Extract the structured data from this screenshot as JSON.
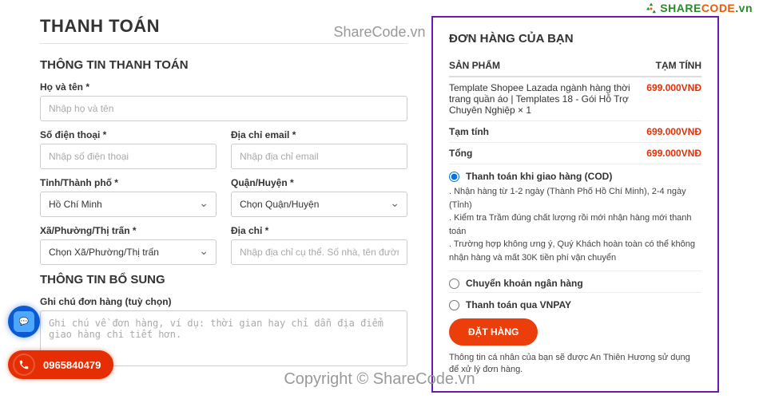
{
  "page_title": "THANH TOÁN",
  "watermark_top": "ShareCode.vn",
  "watermark_bottom": "Copyright © ShareCode.vn",
  "logo_text_1": "SHARE",
  "logo_text_2": "CODE",
  "logo_text_3": ".vn",
  "billing": {
    "heading": "THÔNG TIN THANH TOÁN",
    "fullname_label": "Họ và tên *",
    "fullname_placeholder": "Nhập họ và tên",
    "phone_label": "Số điện thoại *",
    "phone_placeholder": "Nhập số điện thoại",
    "email_label": "Địa chỉ email *",
    "email_placeholder": "Nhập địa chỉ email",
    "province_label": "Tỉnh/Thành phố *",
    "province_value": "Hồ Chí Minh",
    "district_label": "Quận/Huyện *",
    "district_value": "Chọn Quận/Huyện",
    "ward_label": "Xã/Phường/Thị trấn *",
    "ward_value": "Chọn Xã/Phường/Thị trấn",
    "address_label": "Địa chỉ *",
    "address_placeholder": "Nhập địa chỉ cụ thể. Số nhà, tên đường,..."
  },
  "extra": {
    "heading": "THÔNG TIN BỔ SUNG",
    "note_label": "Ghi chú đơn hàng (tuỳ chọn)",
    "note_placeholder": "Ghi chú về đơn hàng, ví dụ: thời gian hay chỉ dẫn địa điểm giao hàng chi tiết hơn."
  },
  "order": {
    "heading": "ĐƠN HÀNG CỦA BẠN",
    "col_product": "SẢN PHẨM",
    "col_subtotal": "TẠM TÍNH",
    "item_name": "Template Shopee Lazada ngành hàng thời trang quần áo | Templates 18 - Gói Hỗ Trợ Chuyên Nghiệp  × 1",
    "item_price": "699.000VNĐ",
    "subtotal_label": "Tạm tính",
    "subtotal_value": "699.000VNĐ",
    "total_label": "Tổng",
    "total_value": "699.000VNĐ",
    "pay_cod": "Thanh toán khi giao hàng (COD)",
    "cod_desc_1": ". Nhận hàng từ 1-2 ngày (Thành Phố Hồ Chí Minh), 2-4 ngày (Tỉnh)",
    "cod_desc_2": ". Kiểm tra Trầm đúng chất lượng rồi mới nhận hàng mới thanh toán",
    "cod_desc_3": ". Trường hợp không ưng ý, Quý Khách hoàn toàn có thể không nhận hàng và mất 30K tiền phí vận chuyển",
    "pay_bank": "Chuyển khoản ngân hàng",
    "pay_vnpay": "Thanh toán qua VNPAY",
    "place_order": "ĐẶT HÀNG",
    "privacy": "Thông tin cá nhân của bạn sẽ được An Thiên Hương sử dụng để xử lý đơn hàng."
  },
  "phone": "0965840479"
}
